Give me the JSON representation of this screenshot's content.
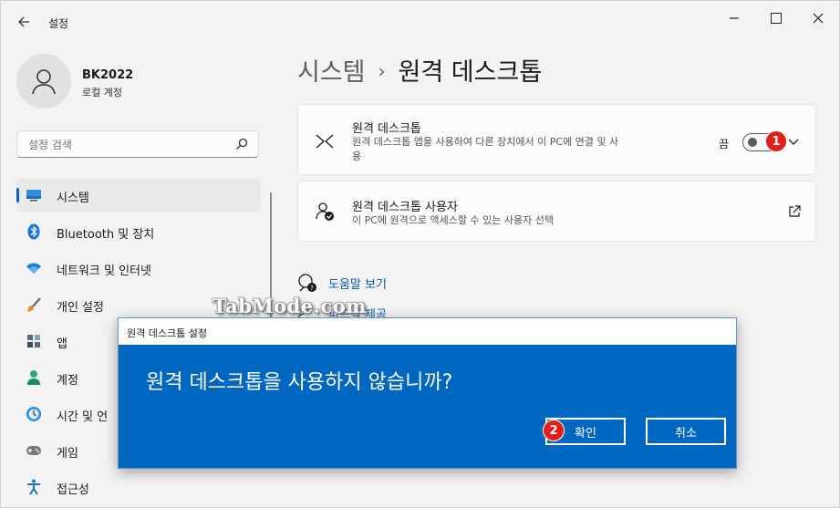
{
  "window": {
    "title": "설정"
  },
  "user": {
    "name": "BK2022",
    "account_type": "로컬 계정"
  },
  "search": {
    "placeholder": "설정 검색"
  },
  "nav": {
    "items": [
      {
        "label": "시스템",
        "icon": "system-icon",
        "active": true
      },
      {
        "label": "Bluetooth 및 장치",
        "icon": "bluetooth-icon"
      },
      {
        "label": "네트워크 및 인터넷",
        "icon": "wifi-icon"
      },
      {
        "label": "개인 설정",
        "icon": "brush-icon"
      },
      {
        "label": "앱",
        "icon": "apps-icon"
      },
      {
        "label": "계정",
        "icon": "account-icon"
      },
      {
        "label": "시간 및 언",
        "icon": "time-icon"
      },
      {
        "label": "게임",
        "icon": "gaming-icon"
      },
      {
        "label": "접근성",
        "icon": "accessibility-icon"
      }
    ]
  },
  "breadcrumb": {
    "parent": "시스템",
    "separator": "›",
    "current": "원격 데스크톱"
  },
  "cards": {
    "remote_desktop": {
      "title": "원격 데스크톱",
      "description": "원격 데스크톱 앱을 사용하여 다른 장치에서 이 PC에 연결 및 사용",
      "toggle_state": "끔",
      "toggle_on": false,
      "icon": "remote-desktop-icon"
    },
    "remote_users": {
      "title": "원격 데스크톱 사용자",
      "description": "이 PC에 원격으로 액세스할 수 있는 사용자 선택",
      "icon": "remote-users-icon"
    }
  },
  "links": {
    "help": "도움말 보기",
    "feedback": "피드백 제공"
  },
  "watermark": "TabMode.com",
  "badges": {
    "first": "1",
    "second": "2"
  },
  "dialog": {
    "title": "원격 데스크톱 설정",
    "message": "원격 데스크톱을 사용하지 않습니까?",
    "ok_label": "확인",
    "cancel_label": "취소"
  },
  "colors": {
    "accent": "#0067c0",
    "badge": "#e0201b",
    "link": "#0b57a5"
  }
}
